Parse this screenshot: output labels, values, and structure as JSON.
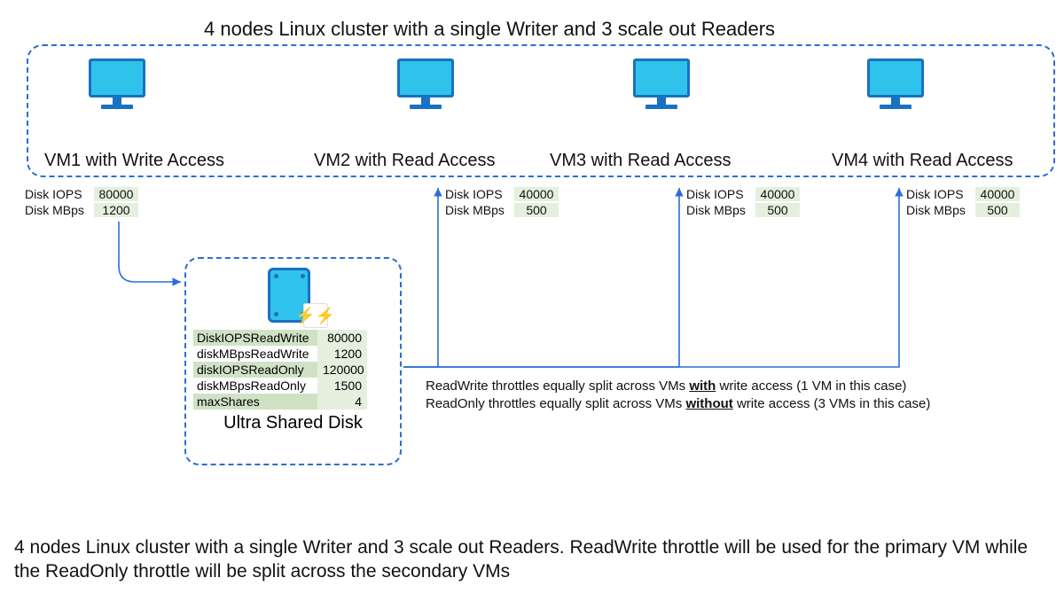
{
  "title": "4 nodes Linux cluster with a single Writer and 3 scale out Readers",
  "vms": [
    {
      "label": "VM1 with Write Access",
      "iops": "80000",
      "mbps": "1200"
    },
    {
      "label": "VM2 with Read Access",
      "iops": "40000",
      "mbps": "500"
    },
    {
      "label": "VM3 with Read Access",
      "iops": "40000",
      "mbps": "500"
    },
    {
      "label": "VM4 with Read Access",
      "iops": "40000",
      "mbps": "500"
    }
  ],
  "stat_labels": {
    "iops": "Disk IOPS",
    "mbps": "Disk MBps"
  },
  "disk": {
    "label": "Ultra Shared Disk",
    "rows": [
      {
        "k": "DiskIOPSReadWrite",
        "v": "80000"
      },
      {
        "k": "diskMBpsReadWrite",
        "v": "1200"
      },
      {
        "k": "diskIOPSReadOnly",
        "v": "120000"
      },
      {
        "k": "diskMBpsReadOnly",
        "v": "1500"
      },
      {
        "k": "maxShares",
        "v": "4"
      }
    ]
  },
  "notes": {
    "line1a": "ReadWrite throttles equally split across VMs ",
    "line1b": "with",
    "line1c": " write access (1 VM in this case)",
    "line2a": "ReadOnly throttles equally split across VMs ",
    "line2b": "without",
    "line2c": " write access (3 VMs in this case)"
  },
  "caption": "4 nodes Linux cluster with a single Writer and 3 scale out Readers. ReadWrite throttle will be used for the primary VM while the ReadOnly throttle will be split across the secondary VMs"
}
